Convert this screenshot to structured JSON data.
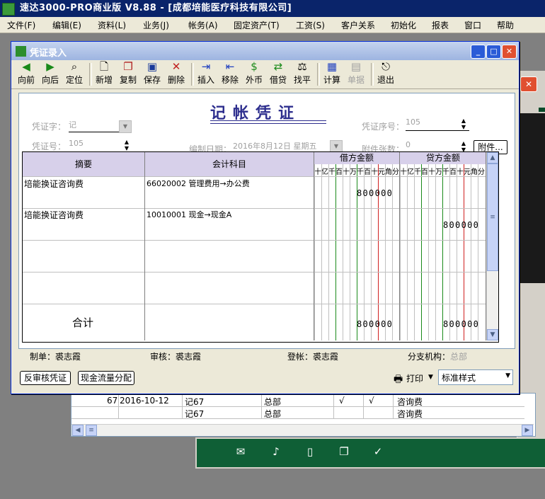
{
  "app": {
    "title": "速达3000-PRO商业版 V8.88 - [成都培能医疗科技有限公司]"
  },
  "menu": [
    "文件(F)",
    "编辑(E)",
    "资料(L)",
    "业务(J)",
    "帐务(A)",
    "固定资产(T)",
    "工资(S)",
    "客户关系",
    "初始化",
    "报表",
    "窗口",
    "帮助"
  ],
  "window": {
    "title": "凭证录入"
  },
  "toolbar": {
    "items": [
      {
        "label": "向前",
        "icon": "arrow-left-icon"
      },
      {
        "label": "向后",
        "icon": "arrow-right-icon"
      },
      {
        "label": "定位",
        "icon": "locate-icon"
      },
      {
        "label": "新增",
        "icon": "new-doc-icon"
      },
      {
        "label": "复制",
        "icon": "copy-icon"
      },
      {
        "label": "保存",
        "icon": "save-icon"
      },
      {
        "label": "删除",
        "icon": "delete-icon"
      },
      {
        "label": "插入",
        "icon": "insert-icon"
      },
      {
        "label": "移除",
        "icon": "remove-icon"
      },
      {
        "label": "外币",
        "icon": "currency-icon"
      },
      {
        "label": "借贷",
        "icon": "debit-credit-icon"
      },
      {
        "label": "找平",
        "icon": "balance-icon"
      },
      {
        "label": "计算",
        "icon": "calculator-icon"
      },
      {
        "label": "单据",
        "icon": "document-icon",
        "disabled": true
      },
      {
        "label": "退出",
        "icon": "exit-icon"
      }
    ]
  },
  "voucher": {
    "title": "记帐凭证",
    "fields": {
      "word_label": "凭证字：",
      "word_value": "记",
      "seq_label": "凭证序号：",
      "seq_value": "105",
      "no_label": "凭证号：",
      "no_value": "105",
      "date_label": "编制日期：",
      "date_value": "2016年8月12日 星期五",
      "attach_label": "附件张数：",
      "attach_value": "0",
      "attach_button": "附件..."
    },
    "columns": {
      "summary": "摘要",
      "account": "会计科目",
      "debit": "借方金额",
      "credit": "贷方金额",
      "digits": [
        "十",
        "亿",
        "千",
        "百",
        "十",
        "万",
        "千",
        "百",
        "十",
        "元",
        "角",
        "分"
      ]
    },
    "rows": [
      {
        "summary": "培能换证咨询费",
        "account": "66020002 管理费用→办公费",
        "debit": "800000",
        "credit": ""
      },
      {
        "summary": "培能换证咨询费",
        "account": "10010001 现金→现金A",
        "debit": "",
        "credit": "800000"
      },
      {
        "summary": "",
        "account": "",
        "debit": "",
        "credit": ""
      },
      {
        "summary": "",
        "account": "",
        "debit": "",
        "credit": ""
      }
    ],
    "total": {
      "label": "合计",
      "debit": "800000",
      "credit": "800000"
    },
    "signatures": {
      "maker_label": "制单：",
      "maker": "裘志霞",
      "auditor_label": "审核：",
      "auditor": "裘志霞",
      "poster_label": "登帐：",
      "poster": "裘志霞",
      "branch_label": "分支机构：",
      "branch": "总部"
    }
  },
  "bottom": {
    "reverse_audit": "反审核凭证",
    "cashflow": "现金流量分配",
    "print": "打印",
    "style": "标准样式"
  },
  "bg_grid": {
    "rows": [
      {
        "n": "67",
        "date": "2016-10-12",
        "voucher": "记67",
        "org": "总部",
        "c1": "√",
        "c2": "√",
        "desc": "咨询费"
      },
      {
        "n": "",
        "date": "",
        "voucher": "记67",
        "org": "总部",
        "c1": "",
        "c2": "",
        "desc": "咨询费"
      }
    ]
  }
}
